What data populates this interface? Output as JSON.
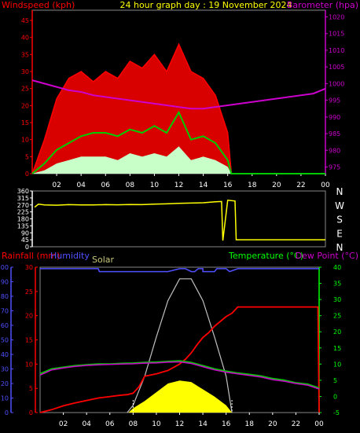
{
  "chart_data": [
    {
      "type": "line",
      "title": "24 hour graph day : 19 November 2024",
      "left_label": "Windspeed (kph)",
      "right_label": "Barometer (hpa)",
      "x_ticks": [
        "02",
        "04",
        "06",
        "08",
        "10",
        "12",
        "14",
        "16",
        "18",
        "20",
        "22",
        "00"
      ],
      "x_range": [
        0,
        24
      ],
      "left_ticks": [
        "0",
        "5",
        "10",
        "15",
        "20",
        "25",
        "30",
        "35",
        "40",
        "45"
      ],
      "left_range": [
        0,
        48
      ],
      "right_ticks": [
        "975",
        "980",
        "985",
        "990",
        "995",
        "1000",
        "1005",
        "1010",
        "1015",
        "1020"
      ],
      "right_range": [
        973,
        1022
      ],
      "colors": {
        "gust": "#ff0000",
        "average": "#00cc00",
        "lull": "#c8ffc8",
        "barometer": "#cc00cc",
        "left_axis": "#ff0000",
        "right_axis": "#cc00cc",
        "title": "#ffff00"
      },
      "series": [
        {
          "key": "barometer",
          "x": [
            0,
            1,
            2,
            3,
            4,
            5,
            6,
            7,
            8,
            9,
            10,
            11,
            12,
            13,
            14,
            15,
            16,
            17,
            18,
            19,
            20,
            21,
            22,
            23,
            24
          ],
          "values": [
            1001,
            1000,
            999,
            998,
            997.5,
            996.5,
            996,
            995.5,
            995,
            994.5,
            994,
            993.5,
            993,
            992.5,
            992.5,
            993,
            993.5,
            994,
            994.5,
            995,
            995.5,
            996,
            996.5,
            997,
            998.5
          ]
        },
        {
          "key": "gust",
          "x": [
            0,
            1,
            2,
            3,
            4,
            5,
            6,
            7,
            8,
            9,
            10,
            11,
            12,
            13,
            14,
            15,
            16,
            16.3,
            24
          ],
          "values": [
            0,
            10,
            22,
            28,
            30,
            27,
            30,
            28,
            33,
            31,
            35,
            30,
            38,
            30,
            28,
            23,
            12,
            0,
            0
          ]
        },
        {
          "key": "average",
          "x": [
            0,
            1,
            2,
            3,
            4,
            5,
            6,
            7,
            8,
            9,
            10,
            11,
            12,
            13,
            14,
            15,
            16,
            16.3,
            24
          ],
          "values": [
            0,
            3,
            7,
            9,
            11,
            12,
            12,
            11,
            13,
            12,
            14,
            12,
            18,
            10,
            11,
            9,
            4,
            0,
            0
          ]
        },
        {
          "key": "lull",
          "x": [
            0,
            1,
            2,
            3,
            4,
            5,
            6,
            7,
            8,
            9,
            10,
            11,
            12,
            13,
            14,
            15,
            16,
            16.3,
            24
          ],
          "values": [
            0,
            1,
            3,
            4,
            5,
            5,
            5,
            4,
            6,
            5,
            6,
            5,
            8,
            4,
            5,
            4,
            2,
            0,
            0
          ]
        }
      ]
    },
    {
      "type": "line",
      "x_ticks": [
        "02",
        "04",
        "06",
        "08",
        "10",
        "12",
        "14",
        "16",
        "18",
        "20",
        "22",
        "00"
      ],
      "x_range": [
        0,
        24
      ],
      "left_ticks": [
        "0",
        "45",
        "90",
        "135",
        "180",
        "225",
        "270",
        "315",
        "360"
      ],
      "left_range": [
        0,
        360
      ],
      "compass_labels": [
        "N",
        "W",
        "S",
        "E",
        "N"
      ],
      "colors": {
        "direction": "#ffff00",
        "axis": "#ffffff"
      },
      "series": [
        {
          "key": "direction",
          "x": [
            0.2,
            0.5,
            1,
            2,
            3,
            4,
            5,
            6,
            7,
            8,
            9,
            10,
            11,
            12,
            13,
            14,
            15,
            15.5,
            15.6,
            16,
            16.6,
            16.7,
            17,
            24
          ],
          "values": [
            255,
            275,
            270,
            268,
            272,
            270,
            270,
            272,
            271,
            273,
            272,
            275,
            277,
            280,
            282,
            284,
            290,
            292,
            40,
            300,
            295,
            45,
            45,
            45
          ]
        }
      ]
    },
    {
      "type": "line",
      "labels": {
        "rainfall": "Rainfall (mm)",
        "humidity": "Humidity",
        "solar": "Solar",
        "temperature": "Temperature (°C)",
        "dewpoint": "Dew Point (°C)"
      },
      "x_ticks": [
        "02",
        "04",
        "06",
        "08",
        "10",
        "12",
        "14",
        "16",
        "18",
        "20",
        "22",
        "00"
      ],
      "x_range": [
        0,
        24
      ],
      "humidity_ticks": [
        "0",
        "10",
        "20",
        "30",
        "40",
        "50",
        "60",
        "70",
        "80",
        "90",
        "100"
      ],
      "humidity_range": [
        0,
        100
      ],
      "rain_ticks": [
        "0",
        "5",
        "10",
        "15",
        "20",
        "25",
        "30"
      ],
      "rain_range": [
        0,
        30
      ],
      "temp_ticks": [
        "-5",
        "0",
        "5",
        "10",
        "15",
        "20",
        "25",
        "30",
        "35",
        "40"
      ],
      "temp_range": [
        -5,
        40
      ],
      "colors": {
        "rainfall": "#ff0000",
        "humidity": "#5050ff",
        "solar_label": "#ffff80",
        "solar": "#ffff00",
        "solar_max": "#c0c0c0",
        "temperature": "#00cc00",
        "dewpoint": "#cc00cc",
        "temp_axis": "#00ff00",
        "dew_label": "#cc00cc"
      },
      "series": [
        {
          "key": "humidity",
          "x": [
            0,
            5,
            5.1,
            11,
            12,
            12.5,
            13,
            13.3,
            13.6,
            14,
            14,
            15,
            15.2,
            16,
            16.3,
            17,
            24
          ],
          "values": [
            99,
            99,
            97,
            97,
            99,
            99,
            97,
            97,
            99,
            99,
            97,
            97,
            99,
            99,
            97,
            99,
            99
          ]
        },
        {
          "key": "temperature",
          "x": [
            0,
            1,
            2,
            3,
            4,
            5,
            6,
            7,
            8,
            9,
            10,
            11,
            12,
            13,
            14,
            15,
            16,
            17,
            18,
            19,
            20,
            21,
            22,
            23,
            24
          ],
          "values": [
            7,
            8.5,
            9,
            9.5,
            9.8,
            10,
            10,
            10.2,
            10.3,
            10.5,
            10.6,
            10.8,
            11,
            10.5,
            9.5,
            8.5,
            7.8,
            7.2,
            6.8,
            6.3,
            5.5,
            5,
            4.2,
            3.8,
            2.6
          ]
        },
        {
          "key": "dewpoint",
          "x": [
            0,
            1,
            2,
            3,
            4,
            5,
            6,
            7,
            8,
            9,
            10,
            11,
            12,
            13,
            14,
            15,
            16,
            17,
            18,
            19,
            20,
            21,
            22,
            23,
            24
          ],
          "values": [
            6.6,
            8.2,
            8.8,
            9.3,
            9.6,
            9.8,
            9.9,
            10,
            10.1,
            10.3,
            10.4,
            10.6,
            10.7,
            10.2,
            9.2,
            8.2,
            7.5,
            7,
            6.5,
            6,
            5.2,
            4.7,
            4,
            3.5,
            2.3
          ]
        },
        {
          "key": "rainfall",
          "x": [
            0,
            1,
            2,
            3,
            4,
            5,
            6,
            7,
            7.5,
            8,
            8.5,
            9,
            10,
            11,
            12,
            12.5,
            13,
            13.5,
            14,
            14.5,
            15,
            16,
            16.5,
            17,
            18,
            23.9,
            24
          ],
          "values": [
            0,
            0.6,
            1.4,
            2,
            2.5,
            3,
            3.3,
            3.6,
            3.7,
            4,
            5.3,
            7.5,
            8,
            8.7,
            10,
            11,
            12.3,
            14,
            15.5,
            16.5,
            17.8,
            19.8,
            20.5,
            21.8,
            21.8,
            21.8,
            0
          ]
        },
        {
          "key": "solar_max",
          "x": [
            7.5,
            8,
            9,
            10,
            11,
            12,
            13,
            14,
            15,
            16,
            16.5
          ],
          "values": [
            0,
            5,
            25,
            52,
            77,
            92,
            92,
            77,
            52,
            25,
            0
          ]
        },
        {
          "key": "solar",
          "x": [
            7.6,
            8,
            9,
            10,
            11,
            12,
            13,
            14,
            15,
            16,
            16.5
          ],
          "values": [
            0,
            3,
            8,
            14,
            20,
            22,
            21,
            16,
            11,
            5,
            0
          ]
        }
      ]
    }
  ]
}
